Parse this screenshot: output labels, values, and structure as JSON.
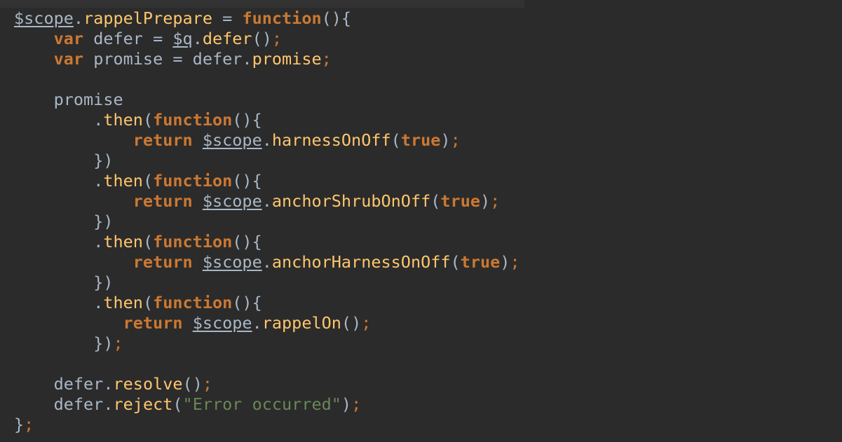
{
  "editor": {
    "language": "javascript",
    "theme_colors": {
      "background": "#2b2b2b",
      "keyword": "#cc7832",
      "identifier": "#a9b7c6",
      "method": "#ffc66d",
      "string": "#6a8759"
    },
    "lines": [
      [
        [
          "var",
          "$scope"
        ],
        [
          "punct",
          "."
        ],
        [
          "method",
          "rappelPrepare"
        ],
        [
          "plain",
          " = "
        ],
        [
          "kw",
          "function"
        ],
        [
          "punct",
          "(){"
        ]
      ],
      [
        [
          "plain",
          "    "
        ],
        [
          "kw",
          "var"
        ],
        [
          "plain",
          " defer = "
        ],
        [
          "var",
          "$q"
        ],
        [
          "punct",
          "."
        ],
        [
          "method",
          "defer"
        ],
        [
          "punct",
          "()"
        ],
        [
          "semi",
          ";"
        ]
      ],
      [
        [
          "plain",
          "    "
        ],
        [
          "kw",
          "var"
        ],
        [
          "plain",
          " promise = defer"
        ],
        [
          "punct",
          "."
        ],
        [
          "method",
          "promise"
        ],
        [
          "semi",
          ";"
        ]
      ],
      [],
      [
        [
          "plain",
          "    promise"
        ]
      ],
      [
        [
          "plain",
          "        "
        ],
        [
          "punct",
          "."
        ],
        [
          "method",
          "then"
        ],
        [
          "punct",
          "("
        ],
        [
          "kw",
          "function"
        ],
        [
          "punct",
          "(){"
        ]
      ],
      [
        [
          "plain",
          "            "
        ],
        [
          "kw",
          "return"
        ],
        [
          "plain",
          " "
        ],
        [
          "var",
          "$scope"
        ],
        [
          "punct",
          "."
        ],
        [
          "method",
          "harnessOnOff"
        ],
        [
          "punct",
          "("
        ],
        [
          "lit",
          "true"
        ],
        [
          "punct",
          ")"
        ],
        [
          "semi",
          ";"
        ]
      ],
      [
        [
          "plain",
          "        "
        ],
        [
          "punct",
          "})"
        ]
      ],
      [
        [
          "plain",
          "        "
        ],
        [
          "punct",
          "."
        ],
        [
          "method",
          "then"
        ],
        [
          "punct",
          "("
        ],
        [
          "kw",
          "function"
        ],
        [
          "punct",
          "(){"
        ]
      ],
      [
        [
          "plain",
          "            "
        ],
        [
          "kw",
          "return"
        ],
        [
          "plain",
          " "
        ],
        [
          "var",
          "$scope"
        ],
        [
          "punct",
          "."
        ],
        [
          "method",
          "anchorShrubOnOff"
        ],
        [
          "punct",
          "("
        ],
        [
          "lit",
          "true"
        ],
        [
          "punct",
          ")"
        ],
        [
          "semi",
          ";"
        ]
      ],
      [
        [
          "plain",
          "        "
        ],
        [
          "punct",
          "})"
        ]
      ],
      [
        [
          "plain",
          "        "
        ],
        [
          "punct",
          "."
        ],
        [
          "method",
          "then"
        ],
        [
          "punct",
          "("
        ],
        [
          "kw",
          "function"
        ],
        [
          "punct",
          "(){"
        ]
      ],
      [
        [
          "plain",
          "            "
        ],
        [
          "kw",
          "return"
        ],
        [
          "plain",
          " "
        ],
        [
          "var",
          "$scope"
        ],
        [
          "punct",
          "."
        ],
        [
          "method",
          "anchorHarnessOnOff"
        ],
        [
          "punct",
          "("
        ],
        [
          "lit",
          "true"
        ],
        [
          "punct",
          ")"
        ],
        [
          "semi",
          ";"
        ]
      ],
      [
        [
          "plain",
          "        "
        ],
        [
          "punct",
          "})"
        ]
      ],
      [
        [
          "plain",
          "        "
        ],
        [
          "punct",
          "."
        ],
        [
          "method",
          "then"
        ],
        [
          "punct",
          "("
        ],
        [
          "kw",
          "function"
        ],
        [
          "punct",
          "(){"
        ]
      ],
      [
        [
          "plain",
          "           "
        ],
        [
          "kw",
          "return"
        ],
        [
          "plain",
          " "
        ],
        [
          "var",
          "$scope"
        ],
        [
          "punct",
          "."
        ],
        [
          "method",
          "rappelOn"
        ],
        [
          "punct",
          "()"
        ],
        [
          "semi",
          ";"
        ]
      ],
      [
        [
          "plain",
          "        "
        ],
        [
          "punct",
          "})"
        ],
        [
          "semi",
          ";"
        ]
      ],
      [],
      [
        [
          "plain",
          "    defer"
        ],
        [
          "punct",
          "."
        ],
        [
          "method",
          "resolve"
        ],
        [
          "punct",
          "()"
        ],
        [
          "semi",
          ";"
        ]
      ],
      [
        [
          "plain",
          "    defer"
        ],
        [
          "punct",
          "."
        ],
        [
          "method",
          "reject"
        ],
        [
          "punct",
          "("
        ],
        [
          "str",
          "\"Error occurred\""
        ],
        [
          "punct",
          ")"
        ],
        [
          "semi",
          ";"
        ]
      ],
      [
        [
          "punct",
          "}"
        ],
        [
          "semi",
          ";"
        ]
      ]
    ]
  }
}
